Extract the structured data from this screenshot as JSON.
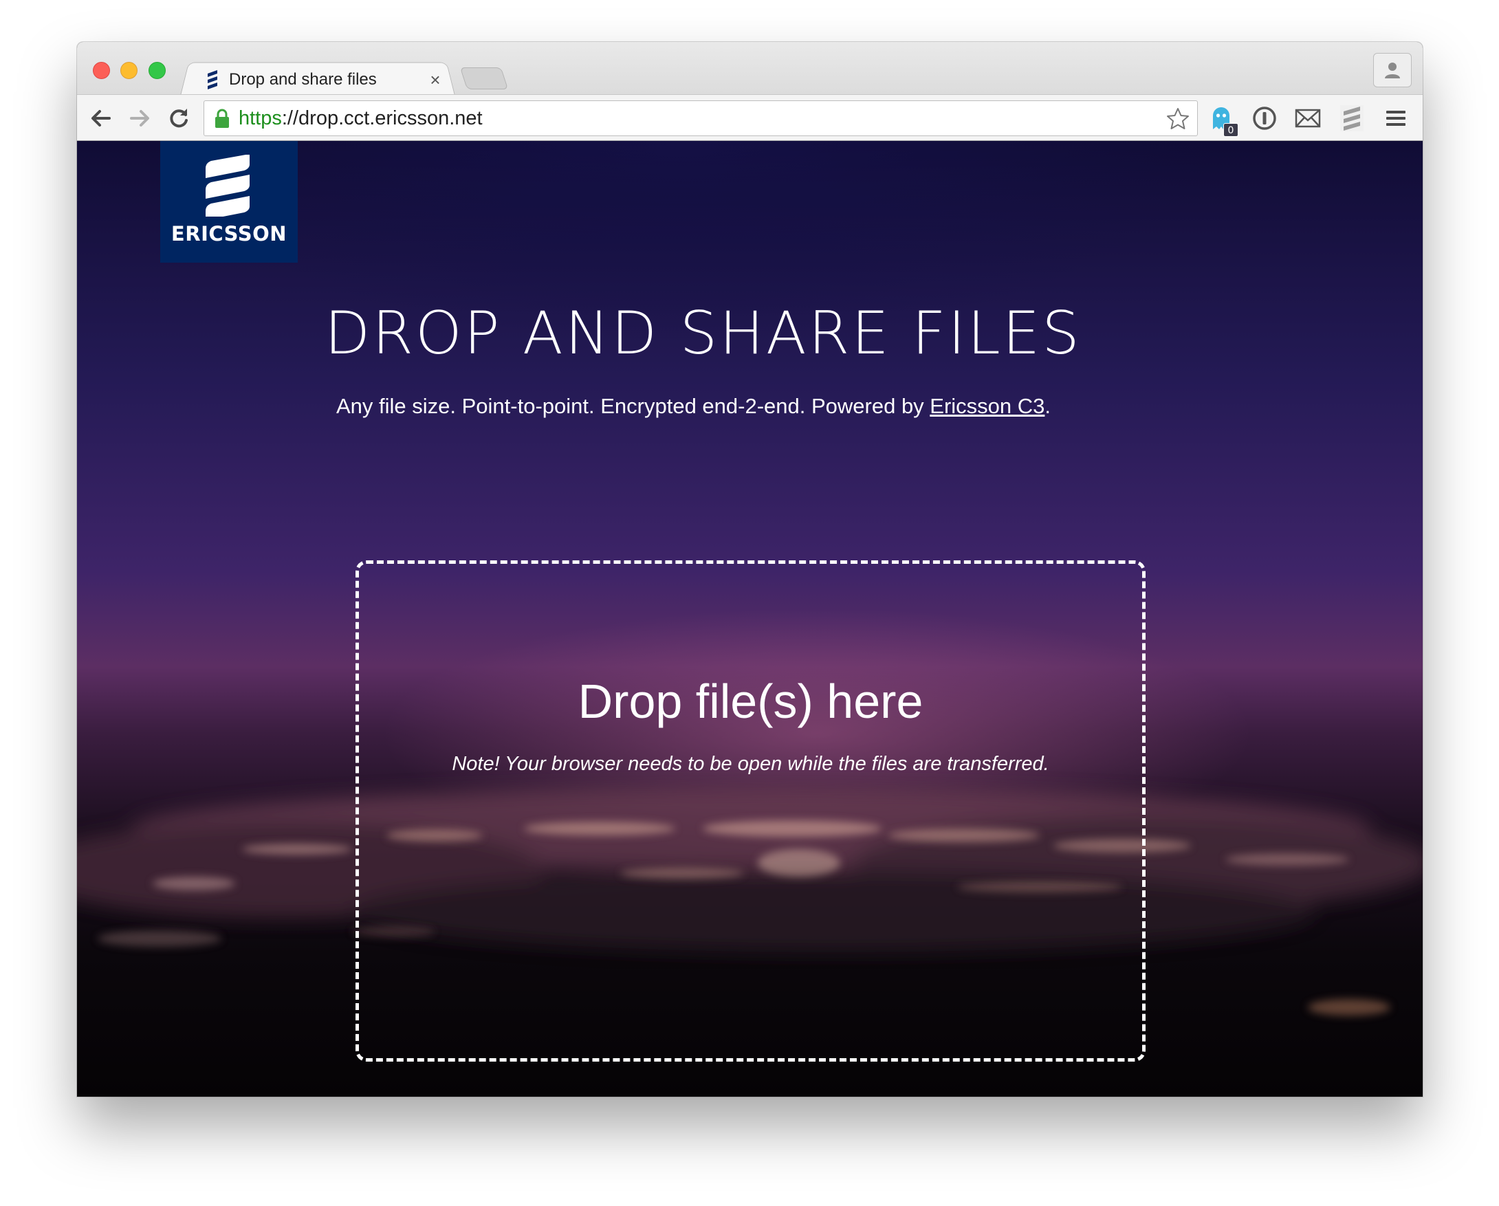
{
  "browser": {
    "tab_title": "Drop and share files",
    "tab_close": "×",
    "url_scheme": "https",
    "url_rest": "://drop.cct.ericsson.net",
    "extension_badge": "0"
  },
  "icons": {
    "back": "back-arrow-icon",
    "forward": "forward-arrow-icon",
    "reload": "reload-icon",
    "lock": "lock-icon",
    "star": "star-icon",
    "ghostery": "ghost-icon",
    "onepassword": "password-key-icon",
    "mail": "mail-icon",
    "ericsson_ext": "ericsson-stripes-icon",
    "menu": "hamburger-menu-icon",
    "profile": "person-icon"
  },
  "logo": {
    "text": "ERICSSON",
    "color": "#002561"
  },
  "hero": {
    "title": "DROP AND SHARE FILES",
    "subtitle_prefix": "Any file size. Point-to-point. Encrypted end-2-end. Powered by ",
    "subtitle_link": "Ericsson C3",
    "subtitle_suffix": "."
  },
  "dropzone": {
    "title": "Drop file(s) here",
    "note": "Note! Your browser needs to be open while the files are transferred."
  },
  "colors": {
    "url_scheme": "#1d8f1d",
    "ericsson_blue": "#002561",
    "close": "#fc5f57",
    "minimize": "#fdbc2f",
    "maximize": "#33c748"
  }
}
